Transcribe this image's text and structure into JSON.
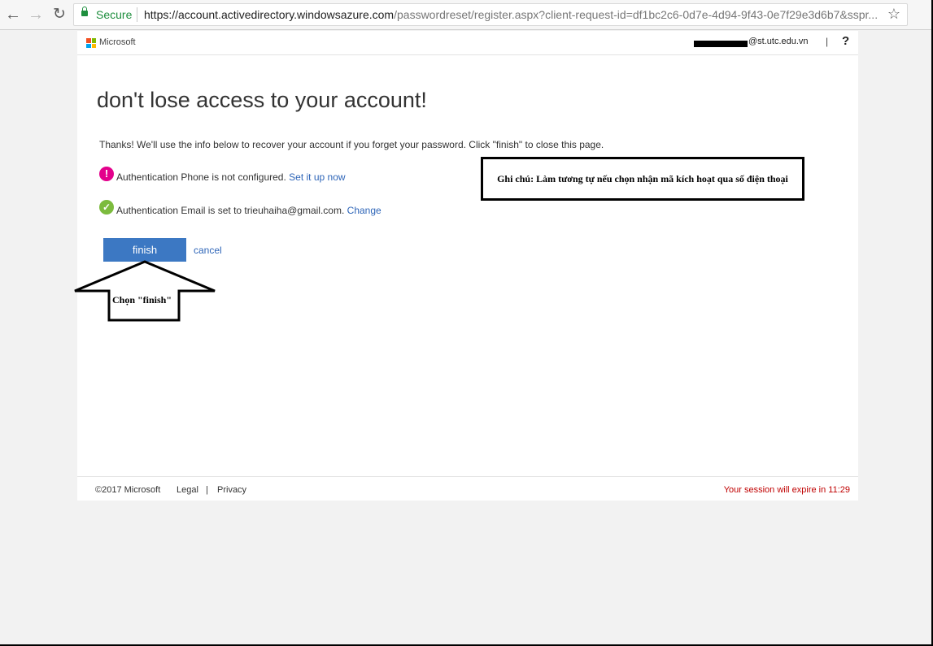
{
  "browser": {
    "secure_label": "Secure",
    "url_host": "https://account.activedirectory.windowsazure.com",
    "url_path": "/passwordreset/register.aspx?client-request-id=df1bc2c6-0d7e-4d94-9f43-0e7f29e3d6b7&sspr...",
    "icons": [
      "back-arrow-icon",
      "forward-arrow-icon",
      "reload-icon",
      "lock-icon",
      "bookmark-star-icon"
    ]
  },
  "header": {
    "brand": "Microsoft",
    "user_email_visible": "@st.utc.edu.vn",
    "separator": "|",
    "help": "?"
  },
  "main": {
    "title": "don't lose access to your account!",
    "intro": "Thanks! We'll use the info below to recover your account if you forget your password. Click \"finish\" to close this page.",
    "phone_status": "Authentication Phone is not configured.",
    "phone_link": "Set it up now",
    "email_status": "Authentication Email is set to trieuhaiha@gmail.com.",
    "email_link": "Change",
    "finish_label": "finish",
    "cancel_label": "cancel"
  },
  "footer": {
    "copyright": "©2017 Microsoft",
    "legal": "Legal",
    "separator": "|",
    "privacy": "Privacy",
    "session": "Your session will expire in 11:29"
  },
  "annotations": {
    "note": "Ghi chú: Làm tương tự nếu chọn nhận mã kích hoạt qua số điện thoại",
    "arrow_label": "Chọn \"finish\""
  },
  "colors": {
    "accent": "#3c78c3",
    "link": "#2e65b8",
    "warning": "#e3008c",
    "success": "#7cbb3e",
    "session_warning": "#c00000"
  }
}
